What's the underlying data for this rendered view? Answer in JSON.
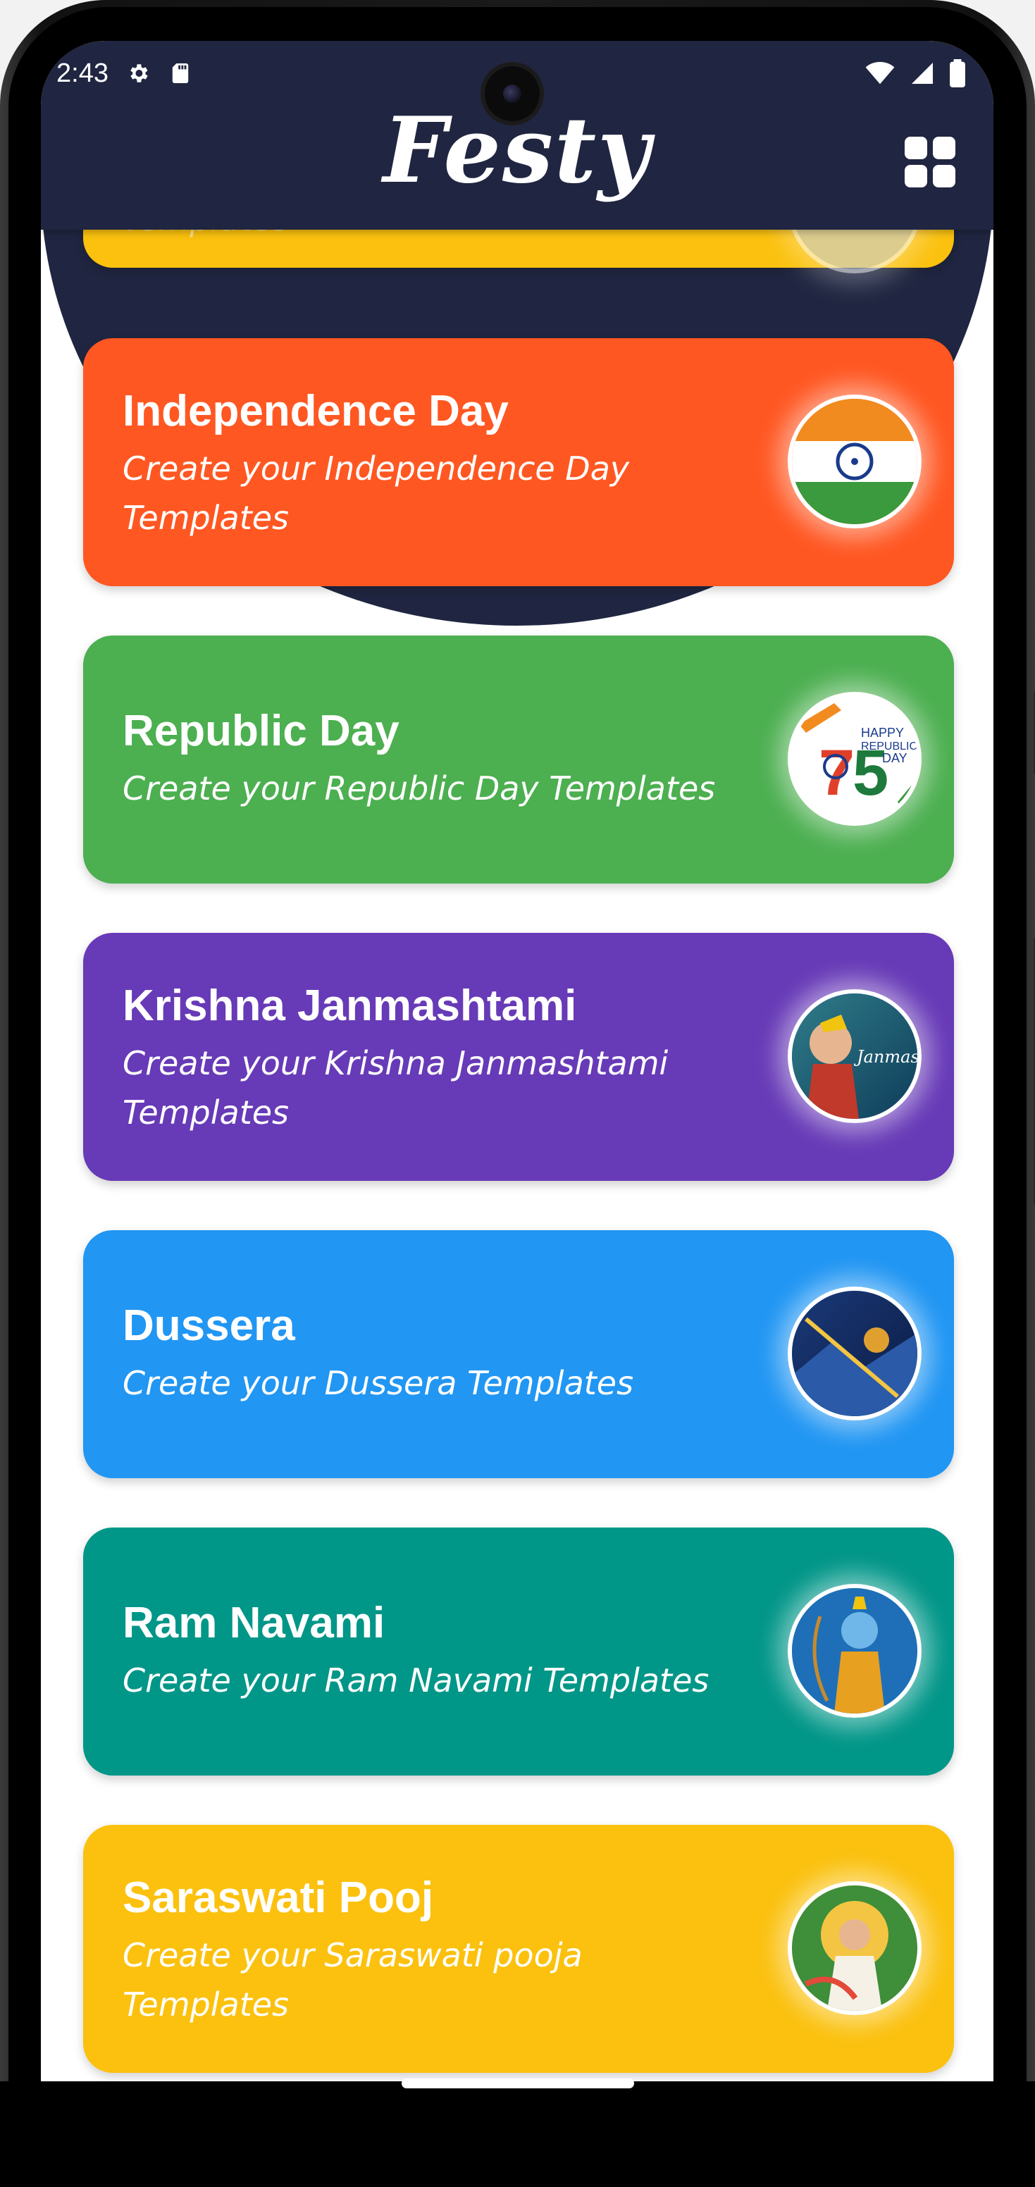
{
  "status_bar": {
    "time": "2:43",
    "left_icons": [
      "gear-icon",
      "sd-card-icon"
    ],
    "right_icons": [
      "wifi-icon",
      "cell-signal-icon",
      "battery-icon"
    ]
  },
  "app_bar": {
    "logo_text": "Festy",
    "menu_icon": "grid-icon",
    "background": "#202641"
  },
  "cards": [
    {
      "title": "",
      "subtitle": "Templates",
      "color": "#FBC10E",
      "thumbnail": "festival-image"
    },
    {
      "title": "Independence Day",
      "subtitle": "Create your Independence Day Templates",
      "color": "#FF5722",
      "thumbnail": "india-flag-image"
    },
    {
      "title": "Republic Day",
      "subtitle": "Create your Republic Day Templates",
      "color": "#4CAF50",
      "thumbnail": "republic-day-75-image"
    },
    {
      "title": "Krishna Janmashtami",
      "subtitle": "Create your Krishna Janmashtami Templates",
      "color": "#673AB7",
      "thumbnail": "krishna-image"
    },
    {
      "title": "Dussera",
      "subtitle": "Create your Dussera Templates",
      "color": "#2196F3",
      "thumbnail": "dussera-image"
    },
    {
      "title": "Ram Navami",
      "subtitle": "Create your Ram Navami Templates",
      "color": "#009688",
      "thumbnail": "ram-image"
    },
    {
      "title": "Saraswati Pooj",
      "subtitle": "Create your Saraswati pooja Templates",
      "color": "#FBC10E",
      "thumbnail": "saraswati-image"
    }
  ]
}
